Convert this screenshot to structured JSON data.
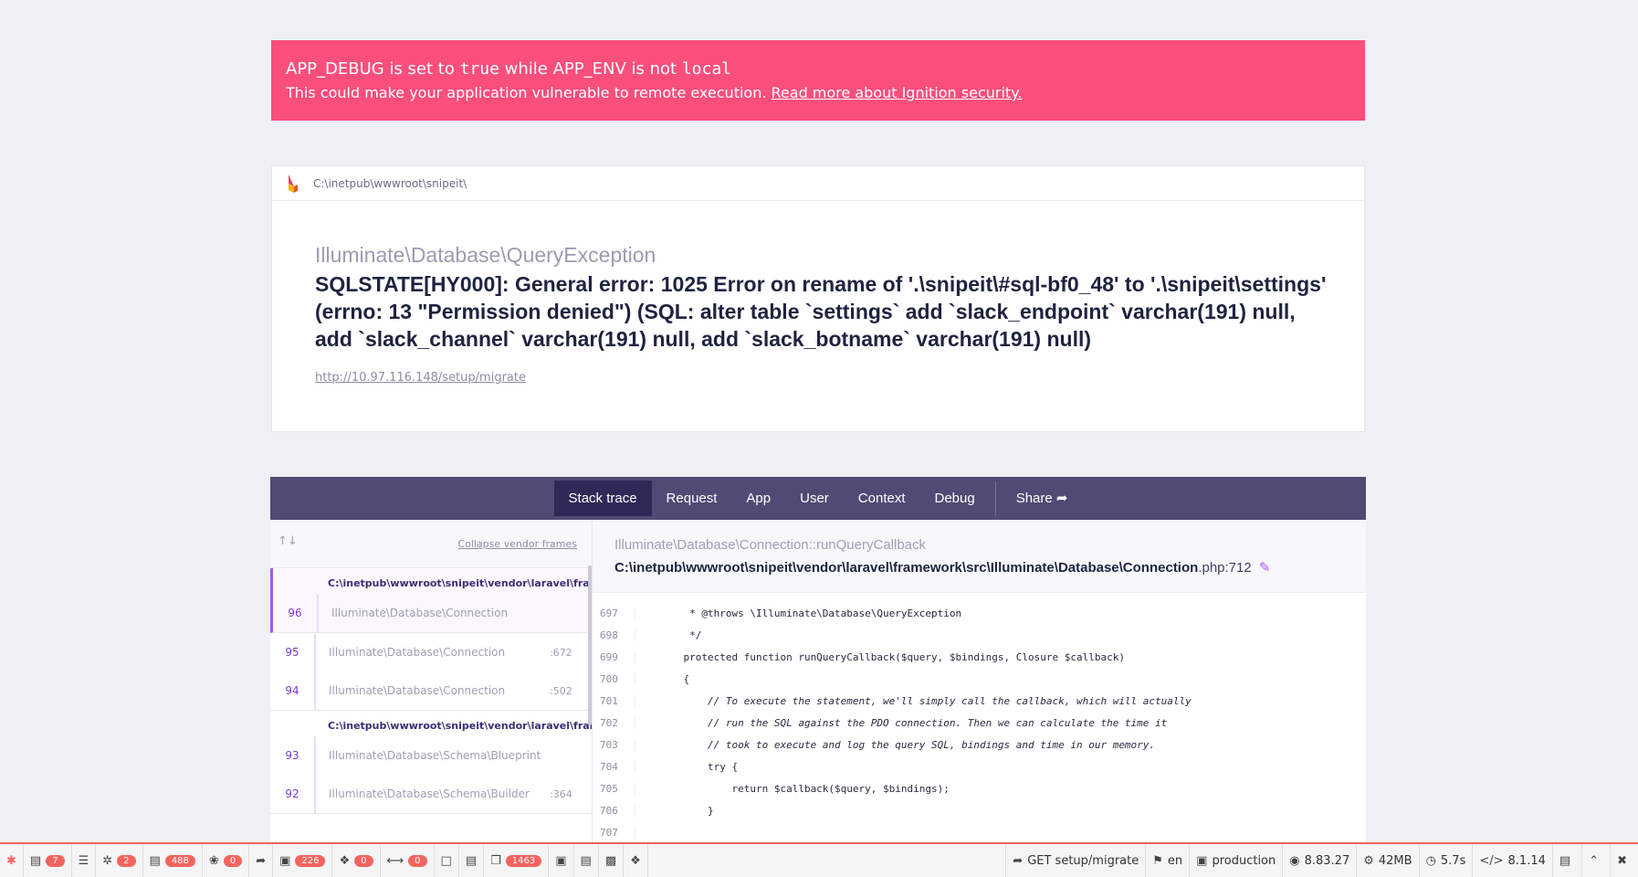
{
  "warning": {
    "var1": "APP_DEBUG",
    "text1": " is set to ",
    "val1": "true",
    "text2": " while ",
    "var2": "APP_ENV",
    "text3": " is not ",
    "val2": "local",
    "line2": "This could make your application vulnerable to remote execution. ",
    "link": "Read more about Ignition security."
  },
  "exception": {
    "path": "C:\\inetpub\\wwwroot\\snipeit\\",
    "class": "Illuminate\\Database\\QueryException",
    "message": "SQLSTATE[HY000]: General error: 1025 Error on rename of '.\\snipeit\\#sql-bf0_48' to '.\\snipeit\\settings' (errno: 13 \"Permission denied\") (SQL: alter table `settings` add `slack_endpoint` varchar(191) null, add `slack_channel` varchar(191) null, add `slack_botname` varchar(191) null)",
    "url": "http://10.97.116.148/setup/migrate"
  },
  "tabs": [
    "Stack trace",
    "Request",
    "App",
    "User",
    "Context",
    "Debug"
  ],
  "share_label": "Share",
  "frames": {
    "collapse_label": "Collapse vendor frames",
    "group1_path": "C:\\inetpub\\wwwroot\\snipeit\\vendor\\laravel\\framework\\src\\Illuminate\\Database\\Connection.php",
    "group2_path": "C:\\inetpub\\wwwroot\\snipeit\\vendor\\laravel\\framework\\src\\Illuminate\\Database\\Schema",
    "items": [
      {
        "num": "96",
        "cls": "Illuminate\\Database\\Connection",
        "line": ""
      },
      {
        "num": "95",
        "cls": "Illuminate\\Database\\Connection",
        "line": ":672"
      },
      {
        "num": "94",
        "cls": "Illuminate\\Database\\Connection",
        "line": ":502"
      },
      {
        "num": "93",
        "cls": "Illuminate\\Database\\Schema\\Blueprint",
        "line": ""
      },
      {
        "num": "92",
        "cls": "Illuminate\\Database\\Schema\\Builder",
        "line": ":364"
      }
    ]
  },
  "source": {
    "method": "Illuminate\\Database\\Connection::runQueryCallback",
    "file": "C:\\inetpub\\wwwroot\\snipeit\\vendor\\laravel\\framework\\src\\Illuminate\\Database\\Connection",
    "ext_line": ".php:712",
    "lines": [
      {
        "n": "697",
        "t": "     * @throws \\Illuminate\\Database\\QueryException"
      },
      {
        "n": "698",
        "t": "     */"
      },
      {
        "n": "699",
        "t": "    protected function runQueryCallback($query, $bindings, Closure $callback)"
      },
      {
        "n": "700",
        "t": "    {"
      },
      {
        "n": "701",
        "t": "        // To execute the statement, we'll simply call the callback, which will actually"
      },
      {
        "n": "702",
        "t": "        // run the SQL against the PDO connection. Then we can calculate the time it"
      },
      {
        "n": "703",
        "t": "        // took to execute and log the query SQL, bindings and time in our memory."
      },
      {
        "n": "704",
        "t": "        try {"
      },
      {
        "n": "705",
        "t": "            return $callback($query, $bindings);"
      },
      {
        "n": "706",
        "t": "        }"
      },
      {
        "n": "707",
        "t": ""
      }
    ]
  },
  "debugbar": {
    "badges": {
      "messages": "7",
      "exceptions": "2",
      "views": "488",
      "route": "0",
      "queries": "226",
      "models": "0",
      "events": "0",
      "mails": "1463"
    },
    "request": "GET setup/migrate",
    "locale": "en",
    "env": "production",
    "laravel": "8.83.27",
    "memory": "42MB",
    "time": "5.7s",
    "php": "8.1.14"
  },
  "colors": {
    "banner": "#fa4e7b",
    "tabs": "#4e4b74",
    "accent": "#a855f7",
    "debug_badge": "#f4645f"
  }
}
